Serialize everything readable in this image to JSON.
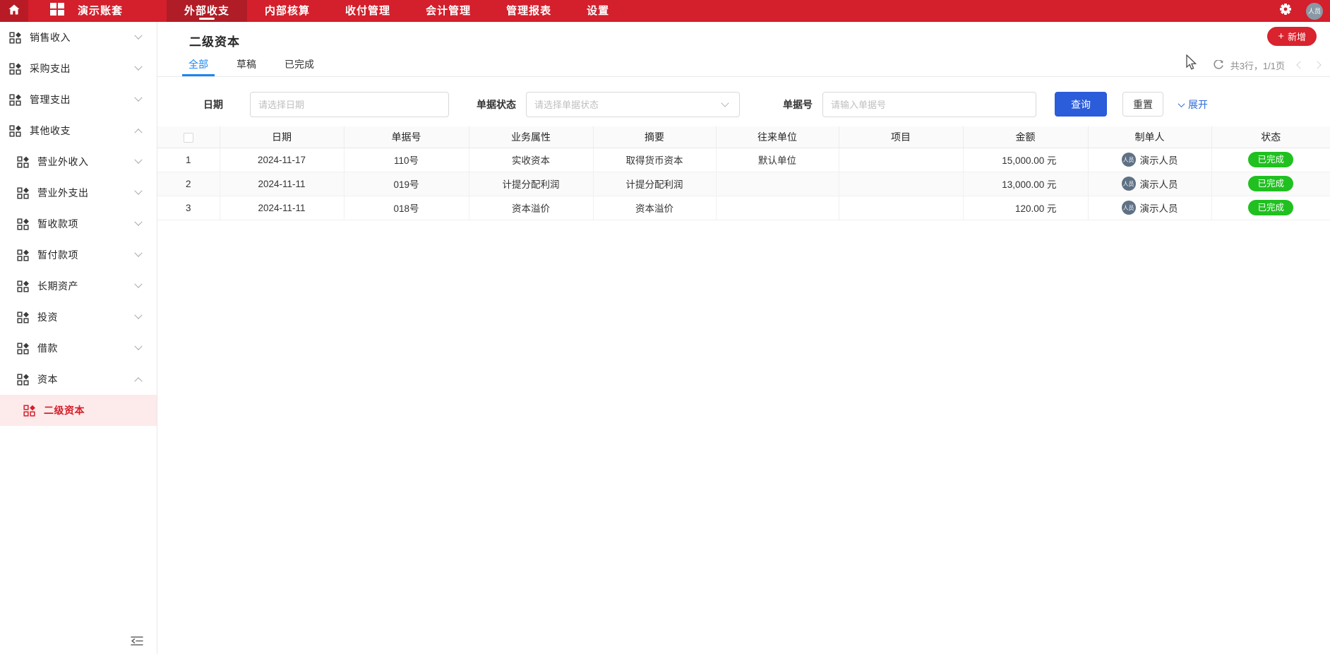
{
  "topbar": {
    "account_name": "演示账套",
    "nav": [
      "外部收支",
      "内部核算",
      "收付管理",
      "会计管理",
      "管理报表",
      "设置"
    ],
    "active_nav": "外部收支",
    "avatar_text": "人员"
  },
  "sidebar": {
    "items": [
      {
        "label": "销售收入"
      },
      {
        "label": "采购支出"
      },
      {
        "label": "管理支出"
      },
      {
        "label": "其他收支"
      },
      {
        "label": "营业外收入"
      },
      {
        "label": "营业外支出"
      },
      {
        "label": "暂收款项"
      },
      {
        "label": "暂付款项"
      },
      {
        "label": "长期资产"
      },
      {
        "label": "投资"
      },
      {
        "label": "借款"
      },
      {
        "label": "资本"
      },
      {
        "label": "二级资本"
      }
    ],
    "selected": "二级资本"
  },
  "page": {
    "title": "二级资本",
    "new_button": "新增",
    "tabs": [
      "全部",
      "草稿",
      "已完成"
    ],
    "active_tab": "全部",
    "pagination_summary": "共3行，1/1页"
  },
  "filters": {
    "date_label": "日期",
    "date_placeholder": "请选择日期",
    "status_label": "单据状态",
    "status_placeholder": "请选择单据状态",
    "docno_label": "单据号",
    "docno_placeholder": "请输入单据号",
    "query_button": "查询",
    "reset_button": "重置",
    "expand_link": "展开"
  },
  "table": {
    "columns": [
      "日期",
      "单据号",
      "业务属性",
      "摘要",
      "往来单位",
      "项目",
      "金额",
      "制单人",
      "状态"
    ],
    "avatar_text": "人员",
    "rows": [
      {
        "index": "1",
        "date": "2024-11-17",
        "doc_no": "110号",
        "biz": "实收资本",
        "summary": "取得货币资本",
        "unit": "默认单位",
        "project": "",
        "amount": "15,000.00 元",
        "creator": "演示人员",
        "status": "已完成"
      },
      {
        "index": "2",
        "date": "2024-11-11",
        "doc_no": "019号",
        "biz": "计提分配利润",
        "summary": "计提分配利润",
        "unit": "",
        "project": "",
        "amount": "13,000.00 元",
        "creator": "演示人员",
        "status": "已完成"
      },
      {
        "index": "3",
        "date": "2024-11-11",
        "doc_no": "018号",
        "biz": "资本溢价",
        "summary": "资本溢价",
        "unit": "",
        "project": "",
        "amount": "120.00 元",
        "creator": "演示人员",
        "status": "已完成"
      }
    ]
  },
  "colors": {
    "brand_red": "#d41f2c",
    "button_red": "#d9232e",
    "primary_blue": "#2b5cd9",
    "tab_blue": "#1a86f0",
    "success_green": "#20c020",
    "selected_item_bg": "#fdeaea"
  }
}
